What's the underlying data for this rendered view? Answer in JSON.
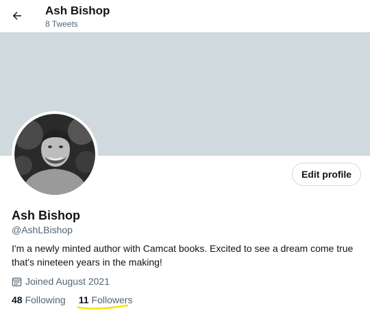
{
  "header": {
    "title": "Ash Bishop",
    "tweets_count": "8 Tweets",
    "back_icon": "arrow-left-icon"
  },
  "colors": {
    "banner": "#cfd9de",
    "text_primary": "#0f1419",
    "text_secondary": "#536471",
    "highlight_underline": "#f5e400"
  },
  "profile": {
    "edit_button_label": "Edit profile",
    "display_name": "Ash Bishop",
    "handle": "@AshLBishop",
    "bio": "I'm a newly minted author with Camcat books.  Excited to see a dream come true that's nineteen years in the making!",
    "joined": "Joined August 2021",
    "calendar_icon": "calendar-icon",
    "following_count": "48",
    "following_label": "Following",
    "followers_count": "11",
    "followers_label": "Followers"
  }
}
